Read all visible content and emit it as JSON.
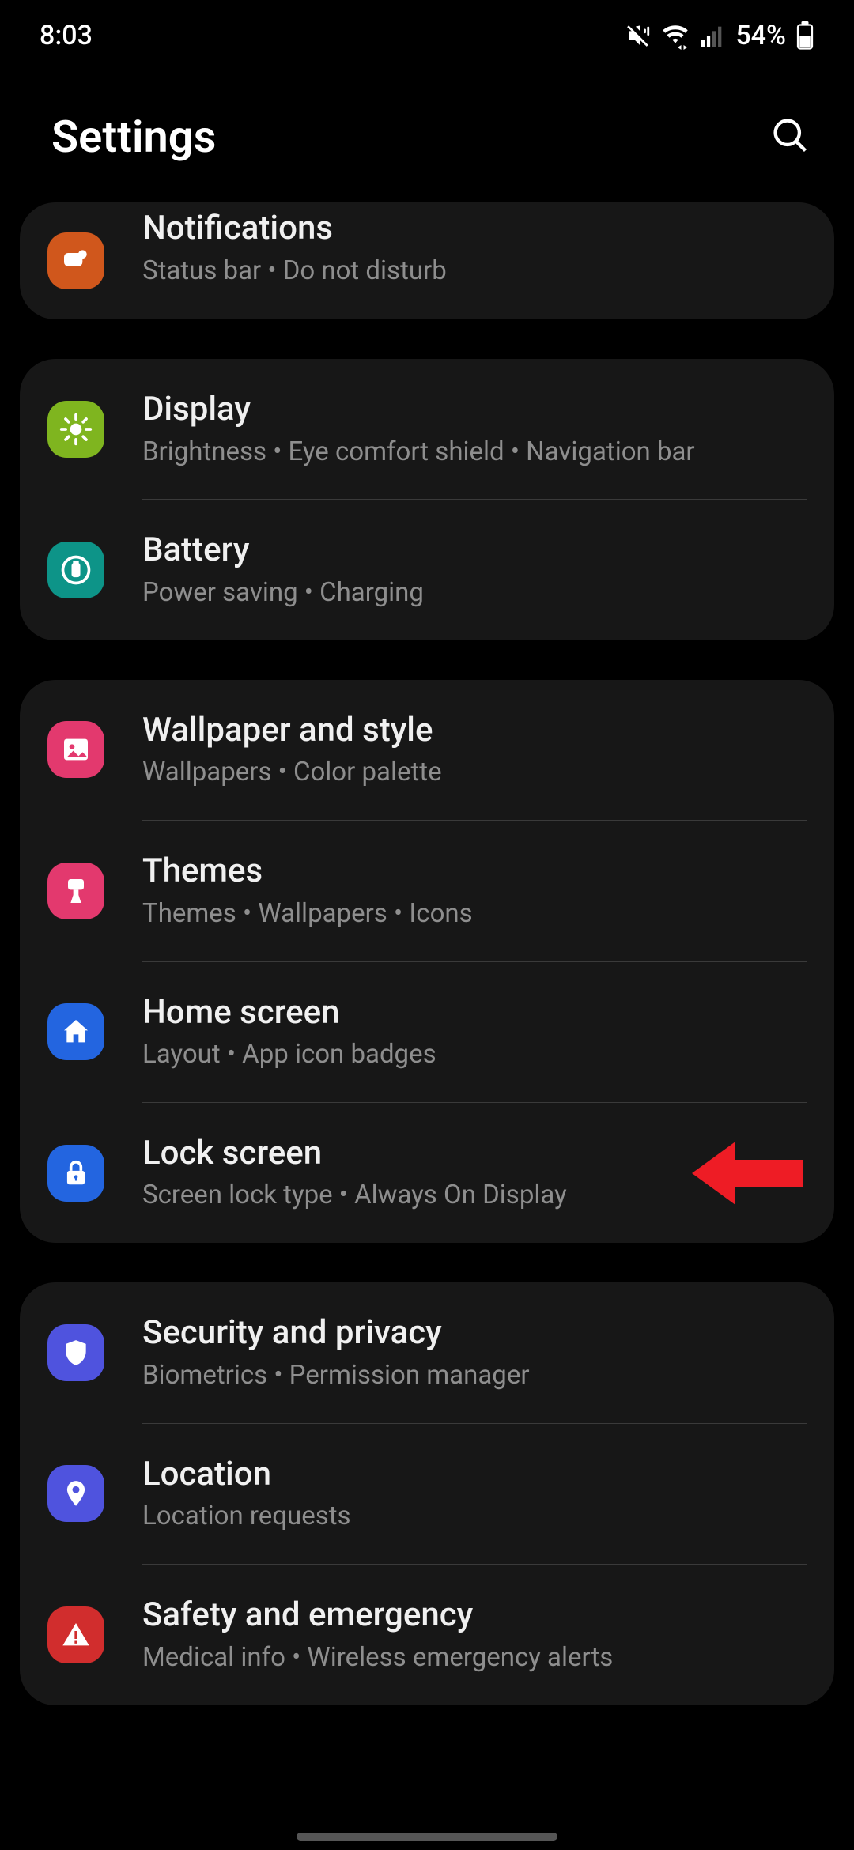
{
  "status": {
    "time": "8:03",
    "battery": "54%"
  },
  "header": {
    "title": "Settings"
  },
  "groups": [
    {
      "cutTop": true,
      "items": [
        {
          "key": "notifications",
          "title": "Notifications",
          "sub": "Status bar  •  Do not disturb",
          "iconClass": "bg-orange",
          "icon": "bell"
        }
      ]
    },
    {
      "items": [
        {
          "key": "display",
          "title": "Display",
          "sub": "Brightness  •  Eye comfort shield  •  Navigation bar",
          "iconClass": "bg-green",
          "icon": "sun"
        },
        {
          "key": "battery",
          "title": "Battery",
          "sub": "Power saving  •  Charging",
          "iconClass": "bg-teal",
          "icon": "battery"
        }
      ]
    },
    {
      "items": [
        {
          "key": "wallpaper",
          "title": "Wallpaper and style",
          "sub": "Wallpapers  •  Color palette",
          "iconClass": "bg-pink",
          "icon": "image"
        },
        {
          "key": "themes",
          "title": "Themes",
          "sub": "Themes  •  Wallpapers  •  Icons",
          "iconClass": "bg-pink2",
          "icon": "brush"
        },
        {
          "key": "homescreen",
          "title": "Home screen",
          "sub": "Layout  •  App icon badges",
          "iconClass": "bg-blue",
          "icon": "home"
        },
        {
          "key": "lockscreen",
          "title": "Lock screen",
          "sub": "Screen lock type  •  Always On Display",
          "iconClass": "bg-blue2",
          "icon": "lock",
          "arrow": true
        }
      ]
    },
    {
      "items": [
        {
          "key": "security",
          "title": "Security and privacy",
          "sub": "Biometrics  •  Permission manager",
          "iconClass": "bg-indigo",
          "icon": "shield"
        },
        {
          "key": "location",
          "title": "Location",
          "sub": "Location requests",
          "iconClass": "bg-indigo2",
          "icon": "pin"
        },
        {
          "key": "safety",
          "title": "Safety and emergency",
          "sub": "Medical info  •  Wireless emergency alerts",
          "iconClass": "bg-red",
          "icon": "alert"
        }
      ]
    }
  ]
}
